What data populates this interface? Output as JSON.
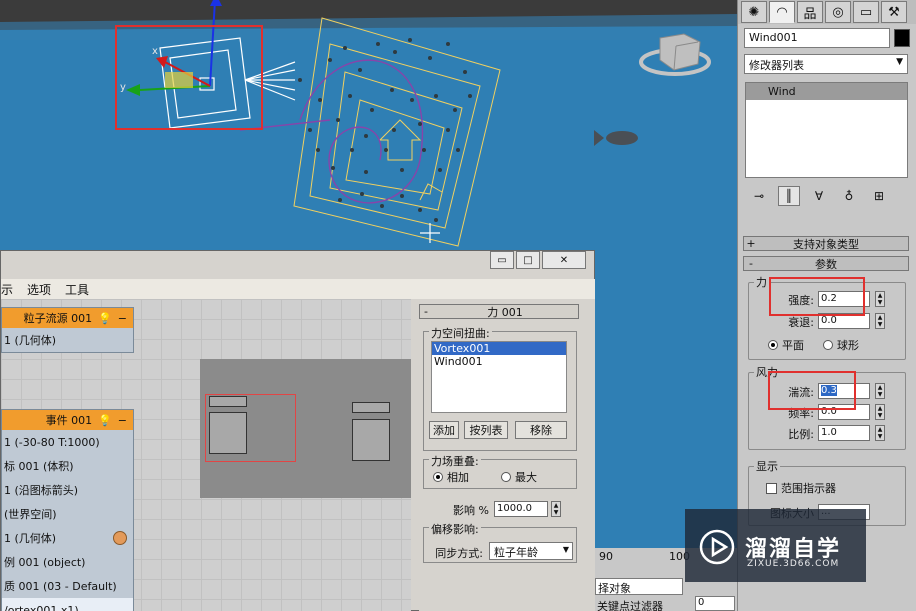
{
  "command_panel": {
    "object_name": "Wind001",
    "modifier_list": "修改器列表",
    "modifier_items": [
      "Wind"
    ],
    "rollouts": {
      "support_types": "支持对象类型",
      "params": "参数"
    },
    "force_group": {
      "title": "力",
      "strength_label": "强度:",
      "strength_value": "0.2",
      "decay_label": "衰退:",
      "decay_value": "0.0",
      "planar_label": "平面",
      "spherical_label": "球形"
    },
    "wind_group": {
      "title": "风力",
      "turbulence_label": "湍流:",
      "turbulence_value": "0.3",
      "frequency_label": "频率:",
      "frequency_value": "0.0",
      "scale_label": "比例:",
      "scale_value": "1.0"
    },
    "display_group": {
      "title": "显示",
      "range_indicators": "范围指示器",
      "icon_size_label": "图标大小",
      "icon_size_value": "..."
    }
  },
  "particle_view": {
    "window_buttons": [
      "▭",
      "□",
      "✕"
    ],
    "menu": [
      "示",
      "选项",
      "工具"
    ],
    "node_source": {
      "title": "粒子流源 001",
      "rows": [
        "1 (几何体)"
      ]
    },
    "node_event": {
      "title": "事件 001",
      "rows": [
        "1 (-30-80 T:1000)",
        "标 001 (体积)",
        "1 (沿图标箭头)",
        "(世界空间)",
        "1 (几何体)",
        "例 001 (object)",
        "质 001 (03 - Default)",
        "/ortex001 x1)"
      ]
    },
    "params": {
      "header": "力 001",
      "space_warps_label": "力空间扭曲:",
      "space_warps": [
        "Vortex001",
        "Wind001"
      ],
      "add_button": "添加",
      "by_list_button": "按列表",
      "remove_button": "移除",
      "overlap_label": "力场重叠:",
      "additive_label": "相加",
      "max_label": "最大",
      "influence_label": "影响 %",
      "influence_value": "1000.0",
      "offset_label": "偏移影响:",
      "sync_label": "同步方式:",
      "sync_value": "粒子年龄"
    }
  },
  "status": {
    "ruler_marks": [
      "90",
      "100"
    ],
    "object_dropdown": "择对象",
    "key_filter": "关键点过滤器",
    "frame_value": "0"
  },
  "watermark": {
    "brand": "溜溜自学",
    "site": "ZIXUE.3D66.COM"
  },
  "colors": {
    "viewport_blue": "#2f7fb4",
    "viewport_dark": "#3b3b3b",
    "node_orange": "#f19c2d",
    "selection_red": "#e0302e"
  }
}
